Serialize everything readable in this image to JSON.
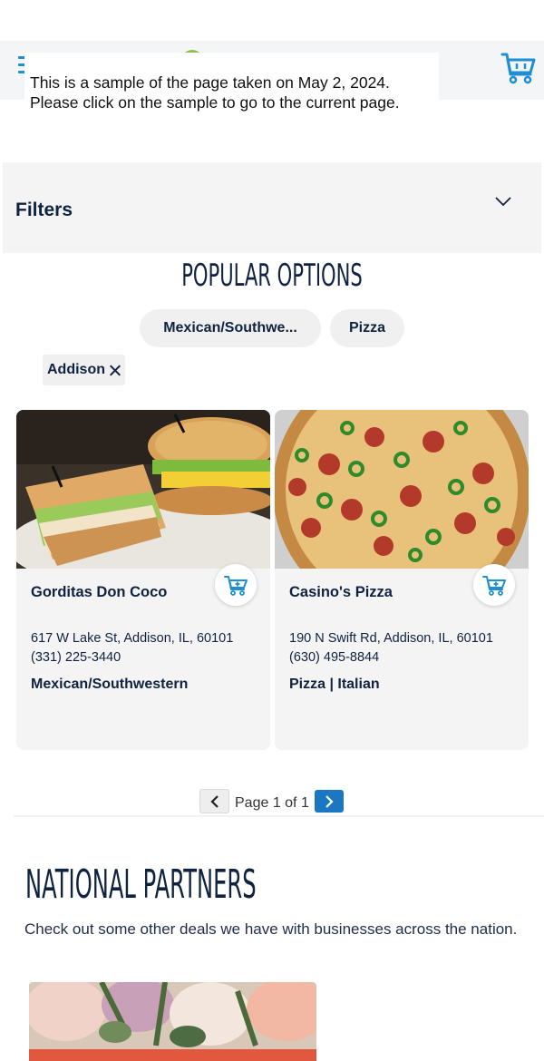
{
  "header": {
    "menu_icon": "hamburger-icon",
    "cart_icon": "shopping-basket-icon",
    "brand_color": "#1f8fd4"
  },
  "banner": {
    "line1": "This is a sample of the page taken on May 2, 2024.",
    "line2": "Please click on the sample to go to the current page."
  },
  "filters": {
    "label": "Filters",
    "toggle_icon": "chevron-down-icon"
  },
  "popular": {
    "title": "POPULAR OPTIONS",
    "options": [
      "Mexican/Southwe...",
      "Pizza"
    ],
    "active_filter": "Addison"
  },
  "listings": [
    {
      "name": "Gorditas Don Coco",
      "address": "617 W Lake St, Addison, IL, 60101",
      "phone": "(331) 225-3440",
      "category": "Mexican/Southwestern",
      "image": "sandwich-photo",
      "action_icon": "add-to-cart-icon"
    },
    {
      "name": "Casino's Pizza",
      "address": "190 N Swift Rd, Addison, IL, 60101",
      "phone": "(630) 495-8844",
      "category": "Pizza | Italian",
      "image": "pizza-photo",
      "action_icon": "add-to-cart-icon"
    }
  ],
  "pagination": {
    "text": "Page 1 of 1",
    "prev_icon": "chevron-left-icon",
    "next_icon": "chevron-right-icon",
    "accent": "#1a78c2"
  },
  "national": {
    "title": "NATIONAL PARTNERS",
    "description": "Check out some other deals we have with businesses across the nation.",
    "image": "flowers-photo"
  }
}
